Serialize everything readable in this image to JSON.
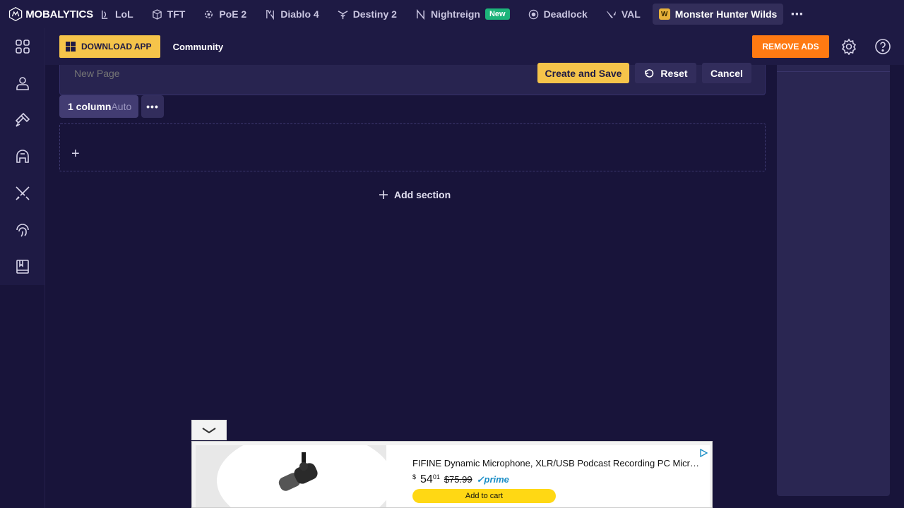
{
  "brand": {
    "name": "MOBALYTICS"
  },
  "nav": {
    "games": [
      {
        "label": "LoL",
        "icon": "lol-icon"
      },
      {
        "label": "TFT",
        "icon": "tft-icon"
      },
      {
        "label": "PoE 2",
        "icon": "poe2-icon"
      },
      {
        "label": "Diablo 4",
        "icon": "diablo4-icon"
      },
      {
        "label": "Destiny 2",
        "icon": "destiny2-icon"
      },
      {
        "label": "Nightreign",
        "icon": "nightreign-icon",
        "badge": "New"
      },
      {
        "label": "Deadlock",
        "icon": "deadlock-icon"
      },
      {
        "label": "VAL",
        "icon": "valorant-icon"
      },
      {
        "label": "Monster Hunter Wilds",
        "icon": "monster-hunter-icon",
        "active": true
      }
    ],
    "more": "⋯"
  },
  "subheader": {
    "download_label": "DOWNLOAD APP",
    "community_label": "Community",
    "remove_ads_label": "REMOVE ADS"
  },
  "editor": {
    "title_placeholder": "New Page",
    "create_label": "Create and Save",
    "reset_label": "Reset",
    "cancel_label": "Cancel",
    "layout_label": "1 column",
    "layout_mode": "Auto",
    "add_section_label": "Add section"
  },
  "ad": {
    "title": "FIFINE Dynamic Microphone, XLR/USB Podcast Recording PC Microphone",
    "currency": "$",
    "price_whole": "54",
    "price_fraction": "01",
    "old_price": "$75.99",
    "prime": "prime",
    "cart_label": "Add to cart"
  },
  "colors": {
    "background": "#18143a",
    "accent_yellow": "#f5c44a",
    "accent_orange": "#ff7a12",
    "new_badge": "#1db47a"
  }
}
